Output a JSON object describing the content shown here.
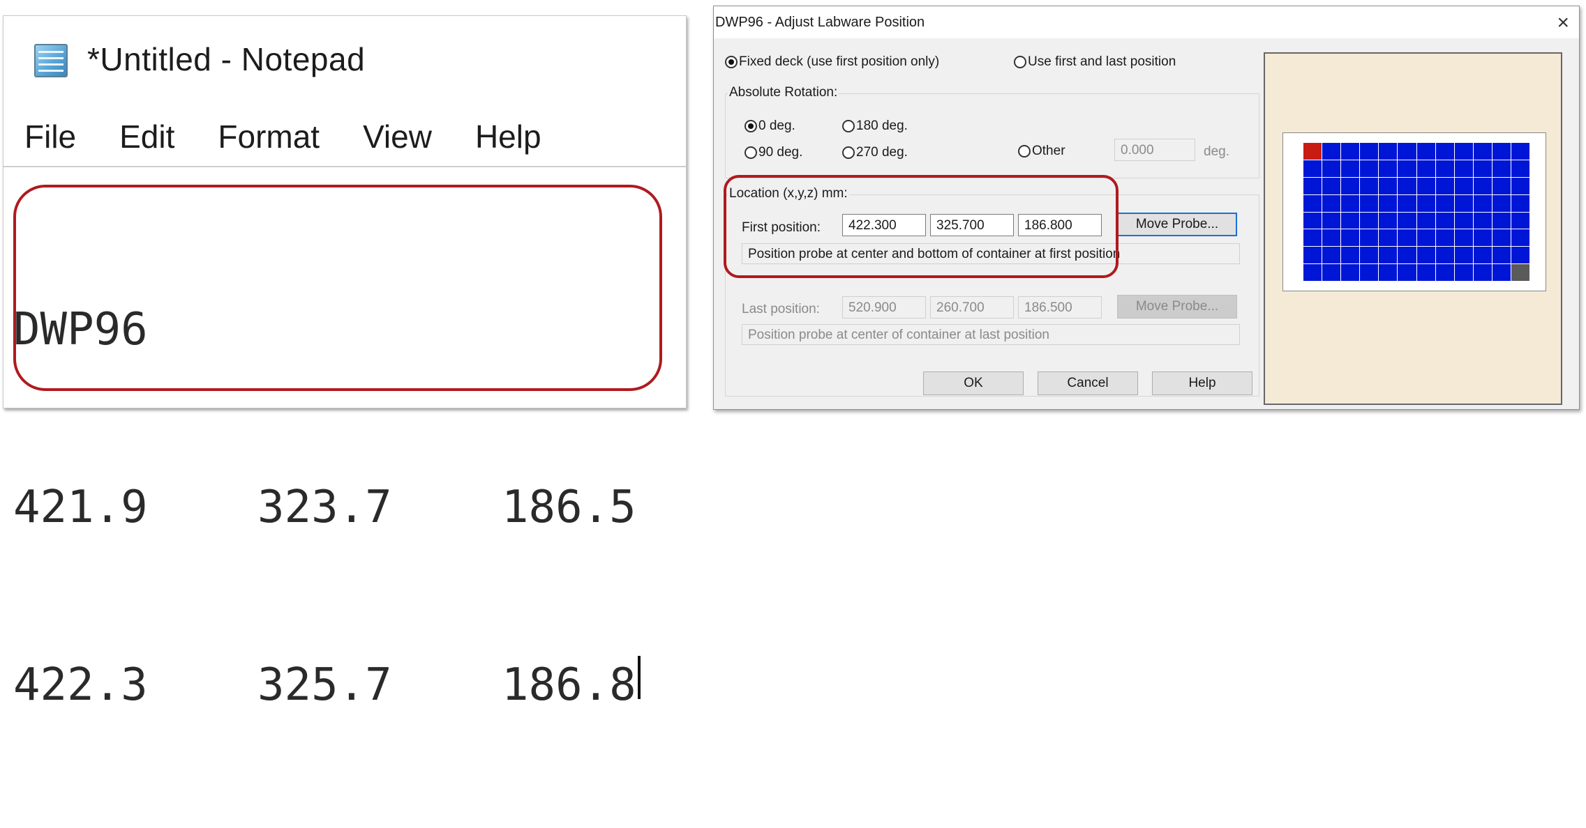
{
  "notepad": {
    "title": "*Untitled - Notepad",
    "menu": [
      "File",
      "Edit",
      "Format",
      "View",
      "Help"
    ],
    "lines": [
      [
        "DWP96"
      ],
      [
        "421.9",
        "323.7",
        "186.5"
      ],
      [
        "422.3",
        "325.7",
        "186.8"
      ]
    ],
    "icon": "notepad-icon",
    "highlight_color": "#b01a1e"
  },
  "dialog": {
    "title": "DWP96 - Adjust Labware Position",
    "close_icon": "×",
    "mode": {
      "fixed_label": "Fixed deck (use first position only)",
      "first_last_label": "Use first and last position",
      "selected": "fixed"
    },
    "rotation": {
      "group_label": "Absolute Rotation:",
      "opt_0": "0 deg.",
      "opt_180": "180 deg.",
      "opt_90": "90 deg.",
      "opt_270": "270 deg.",
      "opt_other": "Other",
      "other_value": "0.000",
      "unit": "deg.",
      "selected": "0 deg."
    },
    "location": {
      "group_label": "Location (x,y,z) mm:",
      "first_label": "First position:",
      "first": {
        "x": "422.300",
        "y": "325.700",
        "z": "186.800"
      },
      "first_button": "Move Probe...",
      "first_hint": "Position probe at center and bottom of container at first position",
      "last_label": "Last position:",
      "last": {
        "x": "520.900",
        "y": "260.700",
        "z": "186.500"
      },
      "last_button": "Move Probe...",
      "last_hint": "Position probe at center of container at last position"
    },
    "buttons": {
      "ok": "OK",
      "cancel": "Cancel",
      "help": "Help"
    },
    "plate": {
      "rows": 8,
      "cols": 12,
      "well_color": "#0016d6",
      "first_well_color": "#c81c12",
      "last_well_color": "#5a5a5a",
      "background": "#f4ead6"
    }
  }
}
